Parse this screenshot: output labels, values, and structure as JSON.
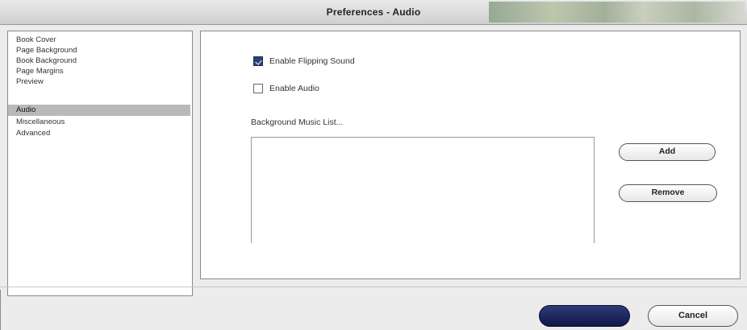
{
  "window": {
    "title": "Preferences - Audio"
  },
  "sidebar": {
    "items": [
      {
        "label": "Book Cover",
        "selected": false
      },
      {
        "label": "Page Background",
        "selected": false
      },
      {
        "label": "Book Background",
        "selected": false
      },
      {
        "label": "Page Margins",
        "selected": false
      },
      {
        "label": "Preview",
        "selected": false
      },
      {
        "label": "Audio",
        "selected": true
      },
      {
        "label": "Miscellaneous",
        "selected": false
      },
      {
        "label": "Advanced",
        "selected": false
      }
    ]
  },
  "audio": {
    "flipping_sound": {
      "label": "Enable Flipping Sound",
      "checked": true
    },
    "enable_audio": {
      "label": "Enable Audio",
      "checked": false
    },
    "music_list_label": "Background Music List...",
    "music_list_items": [],
    "add_label": "Add",
    "remove_label": "Remove"
  },
  "footer": {
    "ok_label": "",
    "cancel_label": "Cancel"
  },
  "colors": {
    "accent": "#1a2458",
    "selection": "#b9b9b9",
    "window_bg": "#ececec"
  }
}
